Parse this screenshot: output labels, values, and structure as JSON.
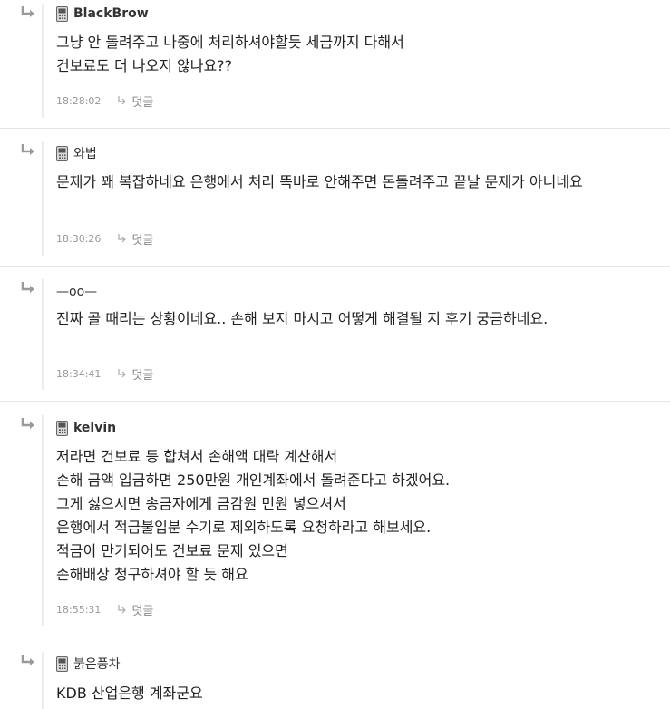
{
  "reply_label": "덧글",
  "comments": [
    {
      "author": "BlackBrow",
      "lines": [
        "그냥 안 돌려주고 나중에 처리하셔야할듯 세금까지 다해서",
        "건보료도 더 나오지 않나요??"
      ],
      "time": "18:28:02"
    },
    {
      "author": "와법",
      "lines": [
        "문제가 꽤 복잡하네요 은행에서 처리 똑바로 안해주면 돈돌려주고 끝날 문제가 아니네요"
      ],
      "time": "18:30:26"
    },
    {
      "author": "—oo—",
      "lines": [
        "진짜 골 때리는 상황이네요.. 손해 보지 마시고 어떻게 해결될 지 후기 궁금하네요."
      ],
      "time": "18:34:41"
    },
    {
      "author": "kelvin",
      "lines": [
        "저라면 건보료 등 합쳐서 손해액 대략 계산해서",
        "손해 금액 입금하면 250만원 개인계좌에서 돌려준다고 하겠어요.",
        "그게 싫으시면 송금자에게 금감원 민원 넣으셔서",
        "은행에서 적금불입분 수기로 제외하도록 요청하라고 해보세요.",
        "적금이 만기되어도 건보료 문제 있으면",
        "손해배상 청구하셔야 할 듯 해요"
      ],
      "time": "18:55:31"
    },
    {
      "author": "붉은풍차",
      "lines": [
        "KDB 산업은행 계좌군요"
      ],
      "time": ""
    }
  ]
}
